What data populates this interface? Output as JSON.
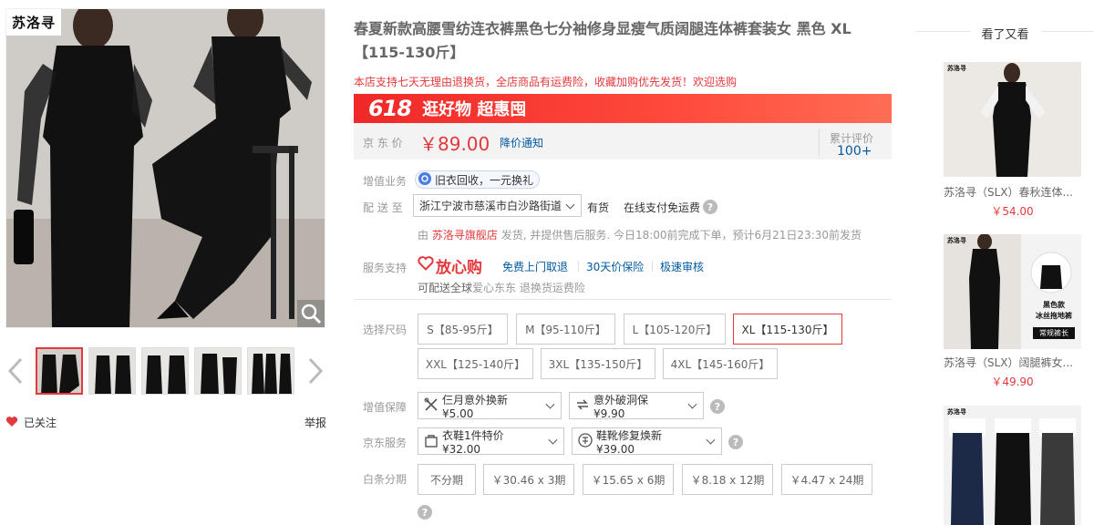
{
  "gallery": {
    "brand_text": "苏洛寻",
    "follow_label": "已关注",
    "report_label": "举报"
  },
  "product": {
    "title": "春夏新款高腰雪纺连衣裤黑色七分袖修身显瘦气质阔腿连体裤套装女 黑色 XL【115-130斤】",
    "promo_text": "本店支持七天无理由退换货，全店商品有运费险，收藏加购优先发货！欢迎选购",
    "banner_618": "618",
    "banner_slogan": "逛好物 超惠囤",
    "price_label": "京 东 价",
    "price": "￥89.00",
    "price_notice": "降价通知",
    "review_label": "累计评价",
    "review_count": "100+"
  },
  "services": {
    "value_added_label": "增值业务",
    "trade_in": "旧衣回收，一元换礼",
    "delivery_label": "配 送 至",
    "address": "浙江宁波市慈溪市白沙路街道",
    "stock": "有货",
    "payment": "在线支付免运费",
    "shipper_prefix": "由",
    "shop_name": "苏洛寻旗舰店",
    "ship_info": "发货, 并提供售后服务. 今日18:00前完成下单，预计6月21日23:30前发货",
    "support_label": "服务支持",
    "fangxingou": "放心购",
    "s1": "免费上门取退",
    "s2": "30天价保险",
    "s3": "极速审核",
    "delivery_note_prefix": "可配送全球",
    "delivery_note_mid": "爱心东东",
    "delivery_note_suffix": " 退换货运费险"
  },
  "sizes": {
    "label": "选择尺码",
    "options": [
      "S【85-95斤】",
      "M【95-110斤】",
      "L【105-120斤】",
      "XL【115-130斤】",
      "XXL【125-140斤】",
      "3XL【135-150斤】",
      "4XL【145-160斤】"
    ],
    "selected": "XL【115-130斤】"
  },
  "guarantee": {
    "label": "增值保障",
    "opt1": "仨月意外换新 ¥5.00",
    "opt2": "意外破洞保 ¥9.90"
  },
  "jd_service": {
    "label": "京东服务",
    "opt1": "衣鞋1件特价 ¥32.00",
    "opt2": "鞋靴修复焕新 ¥39.00"
  },
  "installment": {
    "label": "白条分期",
    "options": [
      "不分期",
      "￥30.46 x 3期",
      "￥15.65 x 6期",
      "￥8.18 x 12期",
      "￥4.47 x 24期"
    ]
  },
  "sidebar": {
    "title": "看了又看",
    "items": [
      {
        "name": "苏洛寻（SLX）春秋连体...",
        "price": "￥54.00"
      },
      {
        "name": "苏洛寻（SLX）阔腿裤女...",
        "price": "￥49.90",
        "tag1": "黑色款",
        "tag2": "冰丝拖地裤",
        "tag3": "常规裤长"
      },
      {
        "name": "",
        "price": ""
      }
    ]
  },
  "colors": {
    "accent": "#e4393c",
    "link": "#005aa0"
  }
}
